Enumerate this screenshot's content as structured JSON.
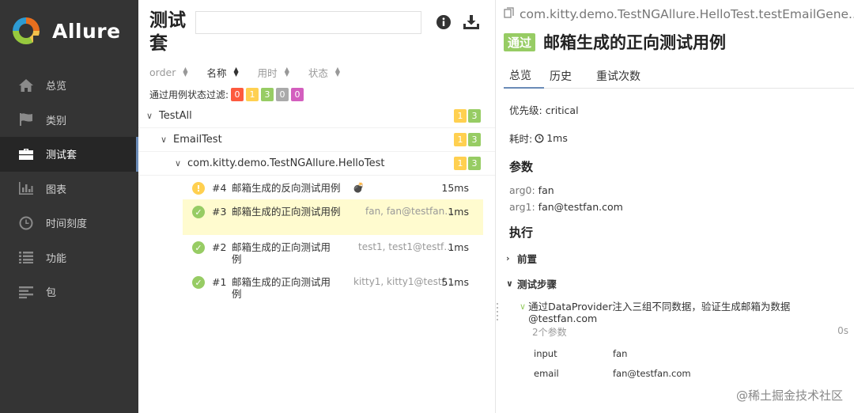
{
  "sidebar": {
    "brand": "Allure",
    "items": [
      {
        "label": "总览",
        "icon": "home-icon"
      },
      {
        "label": "类别",
        "icon": "flag-icon"
      },
      {
        "label": "测试套",
        "icon": "briefcase-icon",
        "active": true
      },
      {
        "label": "图表",
        "icon": "bar-chart-icon"
      },
      {
        "label": "时间刻度",
        "icon": "clock-icon"
      },
      {
        "label": "功能",
        "icon": "list-icon"
      },
      {
        "label": "包",
        "icon": "align-left-icon"
      }
    ]
  },
  "suites": {
    "title": "测试套",
    "search_value": "",
    "sort_columns": [
      {
        "label": "order",
        "active": false
      },
      {
        "label": "名称",
        "active": true
      },
      {
        "label": "用时",
        "active": false
      },
      {
        "label": "状态",
        "active": false
      }
    ],
    "filter_label": "通过用例状态过滤:",
    "filter_counts": [
      "0",
      "1",
      "3",
      "0",
      "0"
    ],
    "tree": [
      {
        "label": "TestAll",
        "broken": "1",
        "passed": "3"
      },
      {
        "label": "EmailTest",
        "broken": "1",
        "passed": "3"
      },
      {
        "label": "com.kitty.demo.TestNGAllure.HelloTest",
        "broken": "1",
        "passed": "3"
      }
    ],
    "cases": [
      {
        "num": "#4",
        "name": "邮箱生成的反向测试用例",
        "params": "",
        "time": "15ms",
        "status": "broken",
        "bomb": "💣"
      },
      {
        "num": "#3",
        "name": "邮箱生成的正向测试用例",
        "params": "fan, fan@testfan.com",
        "time": "1ms",
        "status": "passed"
      },
      {
        "num": "#2",
        "name": "邮箱生成的正向测试用例",
        "params": "test1, test1@testfan.com",
        "time": "1ms",
        "status": "passed"
      },
      {
        "num": "#1",
        "name": "邮箱生成的正向测试用例",
        "params": "kitty1, kitty1@testfan.com",
        "time": "51ms",
        "status": "passed"
      }
    ]
  },
  "detail": {
    "path": "com.kitty.demo.TestNGAllure.HelloTest.testEmailGene...",
    "status": "通过",
    "title": "邮箱生成的正向测试用例",
    "tabs": [
      "总览",
      "历史",
      "重试次数"
    ],
    "priority_label": "优先级:",
    "priority_value": "critical",
    "duration_label": "耗时:",
    "duration_value": "1ms",
    "params_heading": "参数",
    "params": [
      {
        "name": "arg0:",
        "value": "fan"
      },
      {
        "name": "arg1:",
        "value": "fan@testfan.com"
      }
    ],
    "exec_heading": "执行",
    "setup_label": "前置",
    "steps_label": "测试步骤",
    "step_title": "通过DataProvider注入三组不同数据，验证生成邮箱为数据@testfan.com",
    "step_param_count": "2个参数",
    "step_time": "0s",
    "step_params": [
      {
        "name": "input",
        "value": "fan"
      },
      {
        "name": "email",
        "value": "fan@testfan.com"
      }
    ]
  },
  "watermark": "@稀土掘金技术社区"
}
